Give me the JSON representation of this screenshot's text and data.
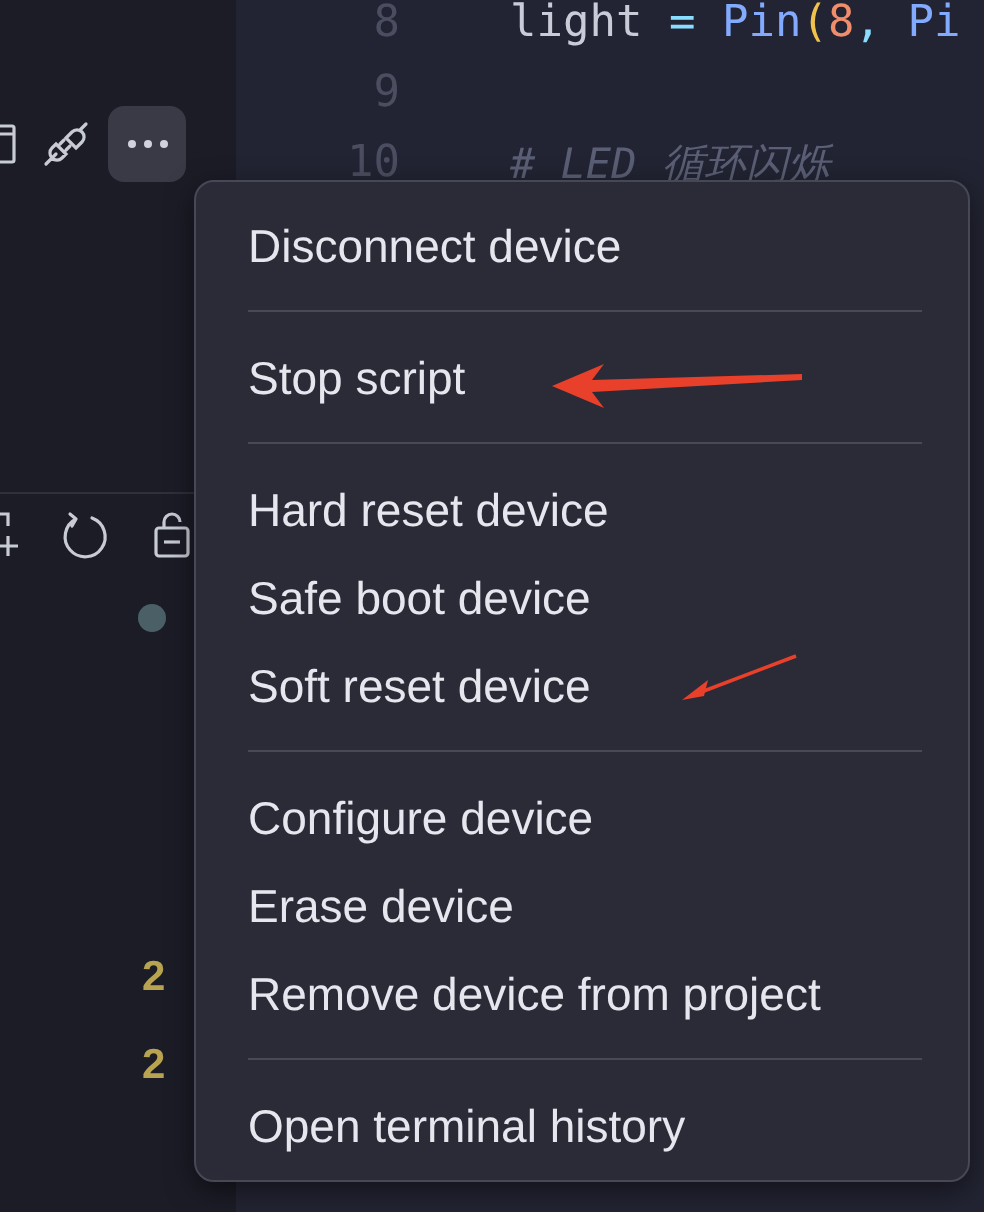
{
  "sidebar": {
    "status_dot": {
      "color": "#4a6066"
    },
    "badges": [
      "2",
      "2"
    ]
  },
  "editor": {
    "lines": [
      {
        "number": "8",
        "tokens": [
          {
            "text": "light ",
            "kind": "name"
          },
          {
            "text": "= ",
            "kind": "op"
          },
          {
            "text": "Pin",
            "kind": "func"
          },
          {
            "text": "(",
            "kind": "paren"
          },
          {
            "text": "8",
            "kind": "num"
          },
          {
            "text": ", ",
            "kind": "op"
          },
          {
            "text": "Pi",
            "kind": "func"
          }
        ]
      },
      {
        "number": "9"
      },
      {
        "number": "10",
        "tokens": [
          {
            "text": "# LED 循环闪烁",
            "kind": "comment"
          }
        ]
      }
    ]
  },
  "menu": {
    "groups": [
      [
        "Disconnect device"
      ],
      [
        "Stop script"
      ],
      [
        "Hard reset device",
        "Safe boot device",
        "Soft reset device"
      ],
      [
        "Configure device",
        "Erase device",
        "Remove device from project"
      ],
      [
        "Open terminal history"
      ]
    ]
  }
}
